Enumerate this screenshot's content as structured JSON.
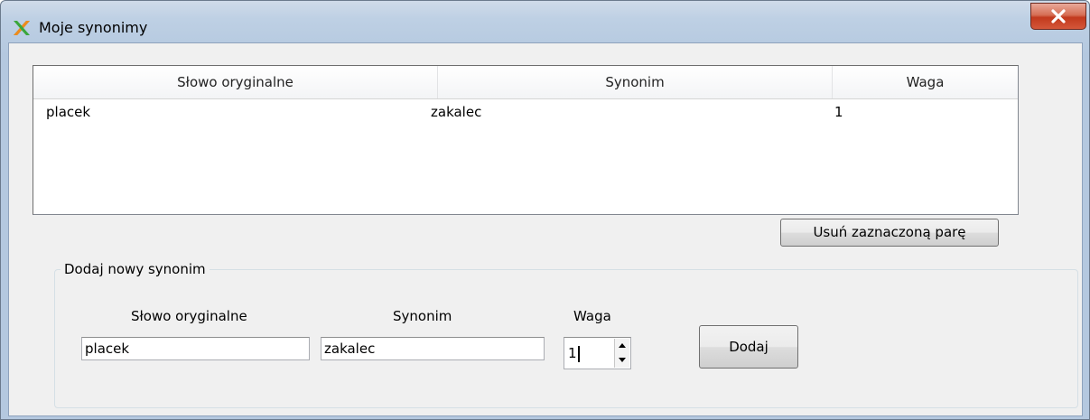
{
  "window": {
    "title": "Moje synonimy",
    "app_icon": "green-orange-x-app-icon",
    "close_icon": "close-icon"
  },
  "list": {
    "columns": [
      "Słowo oryginalne",
      "Synonim",
      "Waga"
    ],
    "rows": [
      {
        "original": "placek",
        "synonym": "zakalec",
        "weight": "1"
      }
    ]
  },
  "buttons": {
    "remove_label": "Usuń zaznaczoną parę",
    "add_label": "Dodaj"
  },
  "add_group": {
    "legend": "Dodaj nowy synonim",
    "original_label": "Słowo oryginalne",
    "synonym_label": "Synonim",
    "weight_label": "Waga",
    "original_value": "placek",
    "synonym_value": "zakalec",
    "weight_value": "1"
  },
  "colors": {
    "close_button": "#c7402a",
    "window_frame": "#b4c8df",
    "client_background": "#f0f0f0"
  }
}
